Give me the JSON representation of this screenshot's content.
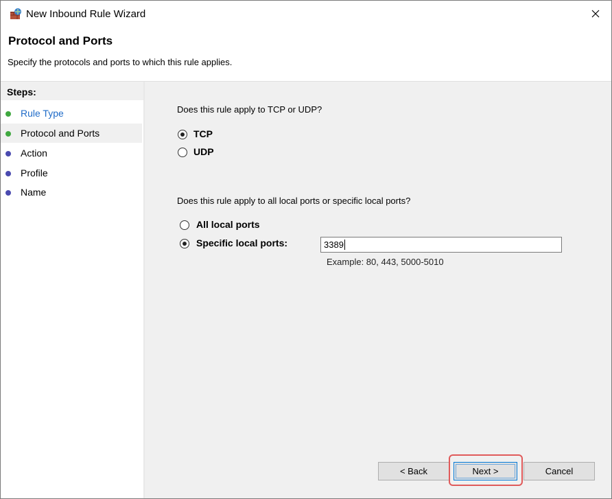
{
  "window": {
    "title": "New Inbound Rule Wizard",
    "icon": "firewall-icon"
  },
  "header": {
    "title": "Protocol and Ports",
    "subtitle": "Specify the protocols and ports to which this rule applies."
  },
  "sidebar": {
    "heading": "Steps:",
    "items": [
      {
        "label": "Rule Type",
        "state": "link",
        "dot_color": "#3fa83f"
      },
      {
        "label": "Protocol and Ports",
        "state": "current",
        "dot_color": "#3fa83f"
      },
      {
        "label": "Action",
        "state": "pending",
        "dot_color": "#4b4bb0"
      },
      {
        "label": "Profile",
        "state": "pending",
        "dot_color": "#4b4bb0"
      },
      {
        "label": "Name",
        "state": "pending",
        "dot_color": "#4b4bb0"
      }
    ]
  },
  "protocol": {
    "question": "Does this rule apply to TCP or UDP?",
    "options": [
      {
        "label": "TCP",
        "selected": true
      },
      {
        "label": "UDP",
        "selected": false
      }
    ]
  },
  "ports": {
    "question": "Does this rule apply to all local ports or specific local ports?",
    "options": [
      {
        "label": "All local ports",
        "selected": false
      },
      {
        "label": "Specific local ports:",
        "selected": true
      }
    ],
    "value": "3389",
    "example": "Example: 80, 443, 5000-5010"
  },
  "buttons": {
    "back": "< Back",
    "next": "Next >",
    "cancel": "Cancel"
  },
  "colors": {
    "link": "#1e6bc8",
    "highlight": "#e05a5a",
    "accent": "#0078d7"
  }
}
